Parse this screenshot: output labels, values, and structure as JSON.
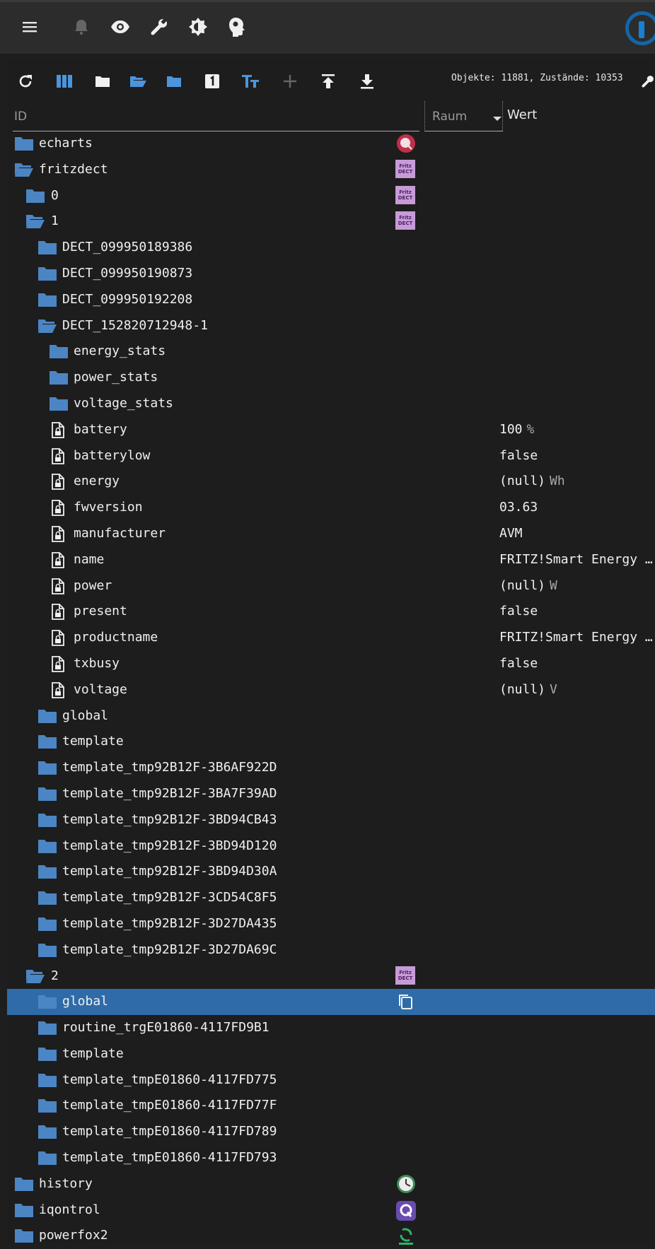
{
  "topbar": {
    "icons": [
      "menu-icon",
      "bell-icon",
      "eye-icon",
      "wrench-icon",
      "brightness-icon",
      "expert-mode-icon"
    ],
    "colors": {
      "background": "#2c2c2c",
      "logo_accent": "#1a7fd6"
    }
  },
  "toolbar": {
    "icons": [
      "refresh-icon",
      "columns-icon",
      "folder-icon",
      "folder-open-icon",
      "folder-blue-icon",
      "number-one-icon",
      "text-size-icon",
      "add-icon",
      "upload-icon",
      "download-icon",
      "settings-icon"
    ],
    "counts_text": "Objekte: 11881, Zustände: 10353"
  },
  "columns": {
    "id": "ID",
    "room": "Raum",
    "value": "Wert"
  },
  "colors": {
    "folder": "#4c85c3",
    "selected": "#2f6ba8",
    "row_text": "#f0f0f0",
    "unit": "#a8a8a8"
  },
  "rows": [
    {
      "name": "echarts",
      "level": 0,
      "type": "folder",
      "adapter": "echarts"
    },
    {
      "name": "fritzdect",
      "level": 0,
      "type": "folder-open",
      "adapter": "fritzdect"
    },
    {
      "name": "0",
      "level": 1,
      "type": "folder",
      "adapter": "fritzdect"
    },
    {
      "name": "1",
      "level": 1,
      "type": "folder-open",
      "adapter": "fritzdect"
    },
    {
      "name": "DECT_099950189386",
      "level": 2,
      "type": "folder"
    },
    {
      "name": "DECT_099950190873",
      "level": 2,
      "type": "folder"
    },
    {
      "name": "DECT_099950192208",
      "level": 2,
      "type": "folder"
    },
    {
      "name": "DECT_152820712948-1",
      "level": 2,
      "type": "folder-open"
    },
    {
      "name": "energy_stats",
      "level": 3,
      "type": "folder"
    },
    {
      "name": "power_stats",
      "level": 3,
      "type": "folder"
    },
    {
      "name": "voltage_stats",
      "level": 3,
      "type": "folder"
    },
    {
      "name": "battery",
      "level": 3,
      "type": "state",
      "value": "100",
      "unit": "%"
    },
    {
      "name": "batterylow",
      "level": 3,
      "type": "state",
      "value": "false"
    },
    {
      "name": "energy",
      "level": 3,
      "type": "state",
      "value": "(null)",
      "unit": "Wh"
    },
    {
      "name": "fwversion",
      "level": 3,
      "type": "state",
      "value": "03.63"
    },
    {
      "name": "manufacturer",
      "level": 3,
      "type": "state",
      "value": "AVM"
    },
    {
      "name": "name",
      "level": 3,
      "type": "state",
      "value": "FRITZ!Smart Energy …"
    },
    {
      "name": "power",
      "level": 3,
      "type": "state",
      "value": "(null)",
      "unit": "W"
    },
    {
      "name": "present",
      "level": 3,
      "type": "state",
      "value": "false"
    },
    {
      "name": "productname",
      "level": 3,
      "type": "state",
      "value": "FRITZ!Smart Energy …"
    },
    {
      "name": "txbusy",
      "level": 3,
      "type": "state",
      "value": "false"
    },
    {
      "name": "voltage",
      "level": 3,
      "type": "state",
      "value": "(null)",
      "unit": "V"
    },
    {
      "name": "global",
      "level": 2,
      "type": "folder"
    },
    {
      "name": "template",
      "level": 2,
      "type": "folder"
    },
    {
      "name": "template_tmp92B12F-3B6AF922D",
      "level": 2,
      "type": "folder"
    },
    {
      "name": "template_tmp92B12F-3BA7F39AD",
      "level": 2,
      "type": "folder"
    },
    {
      "name": "template_tmp92B12F-3BD94CB43",
      "level": 2,
      "type": "folder"
    },
    {
      "name": "template_tmp92B12F-3BD94D120",
      "level": 2,
      "type": "folder"
    },
    {
      "name": "template_tmp92B12F-3BD94D30A",
      "level": 2,
      "type": "folder"
    },
    {
      "name": "template_tmp92B12F-3CD54C8F5",
      "level": 2,
      "type": "folder"
    },
    {
      "name": "template_tmp92B12F-3D27DA435",
      "level": 2,
      "type": "folder"
    },
    {
      "name": "template_tmp92B12F-3D27DA69C",
      "level": 2,
      "type": "folder"
    },
    {
      "name": "2",
      "level": 1,
      "type": "folder-open",
      "adapter": "fritzdect"
    },
    {
      "name": "global",
      "level": 2,
      "type": "folder",
      "selected": true,
      "action": "copy"
    },
    {
      "name": "routine_trgE01860-4117FD9B1",
      "level": 2,
      "type": "folder"
    },
    {
      "name": "template",
      "level": 2,
      "type": "folder"
    },
    {
      "name": "template_tmpE01860-4117FD775",
      "level": 2,
      "type": "folder"
    },
    {
      "name": "template_tmpE01860-4117FD77F",
      "level": 2,
      "type": "folder"
    },
    {
      "name": "template_tmpE01860-4117FD789",
      "level": 2,
      "type": "folder"
    },
    {
      "name": "template_tmpE01860-4117FD793",
      "level": 2,
      "type": "folder"
    },
    {
      "name": "history",
      "level": 0,
      "type": "folder",
      "adapter": "history"
    },
    {
      "name": "iqontrol",
      "level": 0,
      "type": "folder",
      "adapter": "iqontrol"
    },
    {
      "name": "powerfox2",
      "level": 0,
      "type": "folder",
      "adapter": "powerfox"
    }
  ]
}
